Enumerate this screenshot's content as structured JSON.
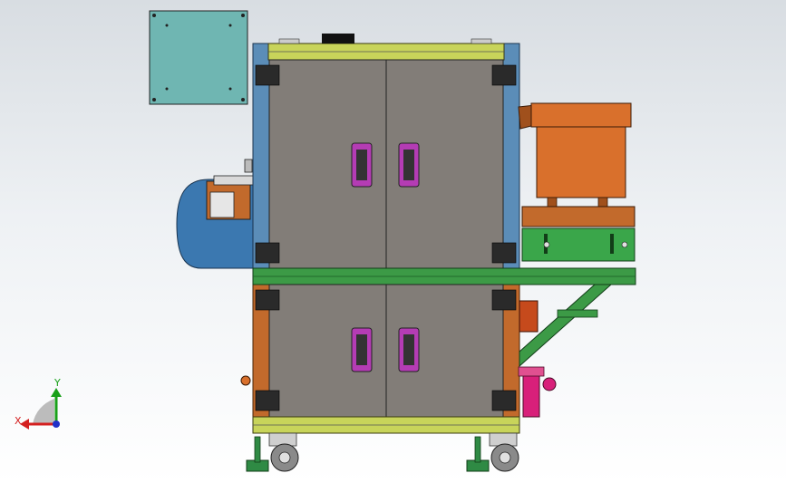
{
  "viewport": {
    "name": "cad-graphics-area",
    "model": "machine-cabinet-assembly"
  },
  "triad": {
    "x_label": "X",
    "y_label": "Y",
    "colors": {
      "x": "#d42020",
      "y": "#19a019",
      "z": "#2030c8"
    }
  },
  "colors": {
    "cabinet_door": "#827d78",
    "frame_blue": "#5b8db8",
    "frame_orange": "#c26a2c",
    "beam_yellow": "#c8d45a",
    "beam_green": "#3c9a46",
    "bowl_orange": "#d9702c",
    "feeder_green": "#3aa64a",
    "control_box": "#6fb6b2",
    "motor_blue": "#3b78b0",
    "handle_magenta": "#b43cb4",
    "filter_pink": "#d8207a",
    "caster_green": "#2f8a44"
  }
}
